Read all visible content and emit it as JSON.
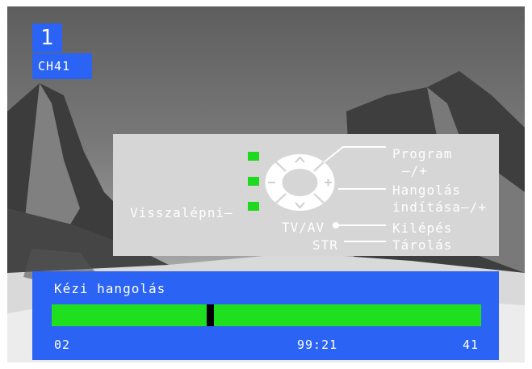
{
  "osd": {
    "program_number": "1",
    "channel": "CH41"
  },
  "help_panel": {
    "program_label": "Program",
    "program_hint": "–/+",
    "tuning_label": "Hangolás",
    "tuning_hint": "indítása–/+",
    "back_label": "Visszalépni–",
    "tvav_label": "TV/AV",
    "exit_label": "Kilépés",
    "str_label": "STR",
    "store_label": "Tárolás",
    "indicator_color": "#1ed91e"
  },
  "tuning": {
    "title": "Kézi hangolás",
    "min": "02",
    "value": "99:21",
    "max": "41",
    "marker_fraction": 0.37,
    "bar_color": "#1ee01e"
  }
}
